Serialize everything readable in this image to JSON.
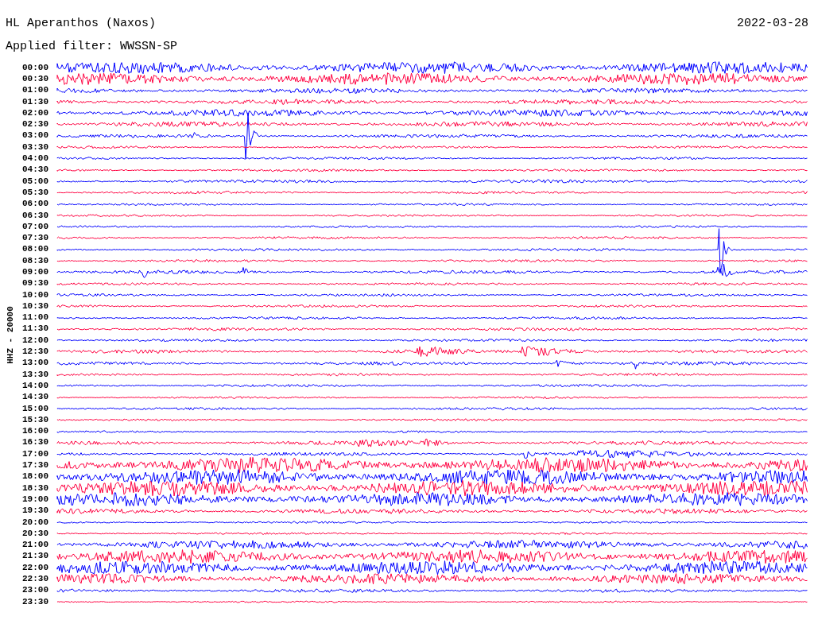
{
  "header": {
    "station": "HL Aperanthos (Naxos)",
    "date": "2022-03-28",
    "filter": "Applied filter: WWSSN-SP"
  },
  "channel_label": "HHZ - 20000",
  "traces": [
    {
      "time": "00:00",
      "color": "#0000ff"
    },
    {
      "time": "00:30",
      "color": "#ff0040"
    },
    {
      "time": "01:00",
      "color": "#0000ff"
    },
    {
      "time": "01:30",
      "color": "#ff0040"
    },
    {
      "time": "02:00",
      "color": "#0000ff"
    },
    {
      "time": "02:30",
      "color": "#ff0040"
    },
    {
      "time": "03:00",
      "color": "#0000ff"
    },
    {
      "time": "03:30",
      "color": "#ff0040"
    },
    {
      "time": "04:00",
      "color": "#0000ff"
    },
    {
      "time": "04:30",
      "color": "#ff0040"
    },
    {
      "time": "05:00",
      "color": "#0000ff"
    },
    {
      "time": "05:30",
      "color": "#ff0040"
    },
    {
      "time": "06:00",
      "color": "#0000ff"
    },
    {
      "time": "06:30",
      "color": "#ff0040"
    },
    {
      "time": "07:00",
      "color": "#0000ff"
    },
    {
      "time": "07:30",
      "color": "#ff0040"
    },
    {
      "time": "08:00",
      "color": "#0000ff"
    },
    {
      "time": "08:30",
      "color": "#ff0040"
    },
    {
      "time": "09:00",
      "color": "#0000ff"
    },
    {
      "time": "09:30",
      "color": "#ff0040"
    },
    {
      "time": "10:00",
      "color": "#0000ff"
    },
    {
      "time": "10:30",
      "color": "#ff0040"
    },
    {
      "time": "11:00",
      "color": "#0000ff"
    },
    {
      "time": "11:30",
      "color": "#ff0040"
    },
    {
      "time": "12:00",
      "color": "#0000ff"
    },
    {
      "time": "12:30",
      "color": "#ff0040"
    },
    {
      "time": "13:00",
      "color": "#0000ff"
    },
    {
      "time": "13:30",
      "color": "#ff0040"
    },
    {
      "time": "14:00",
      "color": "#0000ff"
    },
    {
      "time": "14:30",
      "color": "#ff0040"
    },
    {
      "time": "15:00",
      "color": "#0000ff"
    },
    {
      "time": "15:30",
      "color": "#ff0040"
    },
    {
      "time": "16:00",
      "color": "#0000ff"
    },
    {
      "time": "16:30",
      "color": "#ff0040"
    },
    {
      "time": "17:00",
      "color": "#0000ff"
    },
    {
      "time": "17:30",
      "color": "#ff0040"
    },
    {
      "time": "18:00",
      "color": "#0000ff"
    },
    {
      "time": "18:30",
      "color": "#ff0040"
    },
    {
      "time": "19:00",
      "color": "#0000ff"
    },
    {
      "time": "19:30",
      "color": "#ff0040"
    },
    {
      "time": "20:00",
      "color": "#0000ff"
    },
    {
      "time": "20:30",
      "color": "#ff0040"
    },
    {
      "time": "21:00",
      "color": "#0000ff"
    },
    {
      "time": "21:30",
      "color": "#ff0040"
    },
    {
      "time": "22:00",
      "color": "#0000ff"
    },
    {
      "time": "22:30",
      "color": "#ff0040"
    },
    {
      "time": "23:00",
      "color": "#0000ff"
    },
    {
      "time": "23:30",
      "color": "#ff0040"
    }
  ]
}
